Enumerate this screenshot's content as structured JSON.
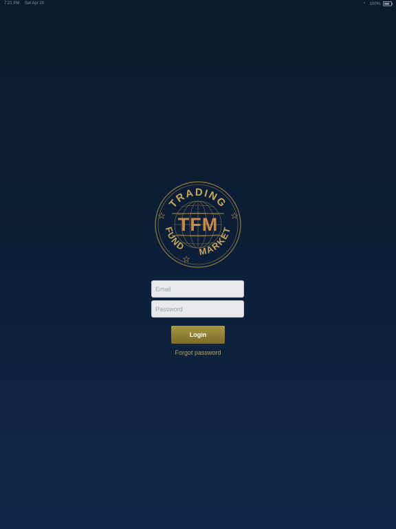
{
  "status_bar": {
    "time": "7:21 PM",
    "date": "Sat Apr 20",
    "battery_percent": "100%"
  },
  "logo": {
    "top_text": "TRADING",
    "center_text": "TFM",
    "bottom_left_text": "FUND",
    "bottom_right_text": "MARKET",
    "icon": "globe-icon"
  },
  "login_form": {
    "email_placeholder": "Email",
    "password_placeholder": "Password",
    "login_label": "Login",
    "forgot_label": "Forgot password"
  },
  "colors": {
    "background_top": "#0b1a2e",
    "background_bottom": "#10294a",
    "accent_gold": "#b8a55a",
    "logo_copper": "#c8884a"
  }
}
